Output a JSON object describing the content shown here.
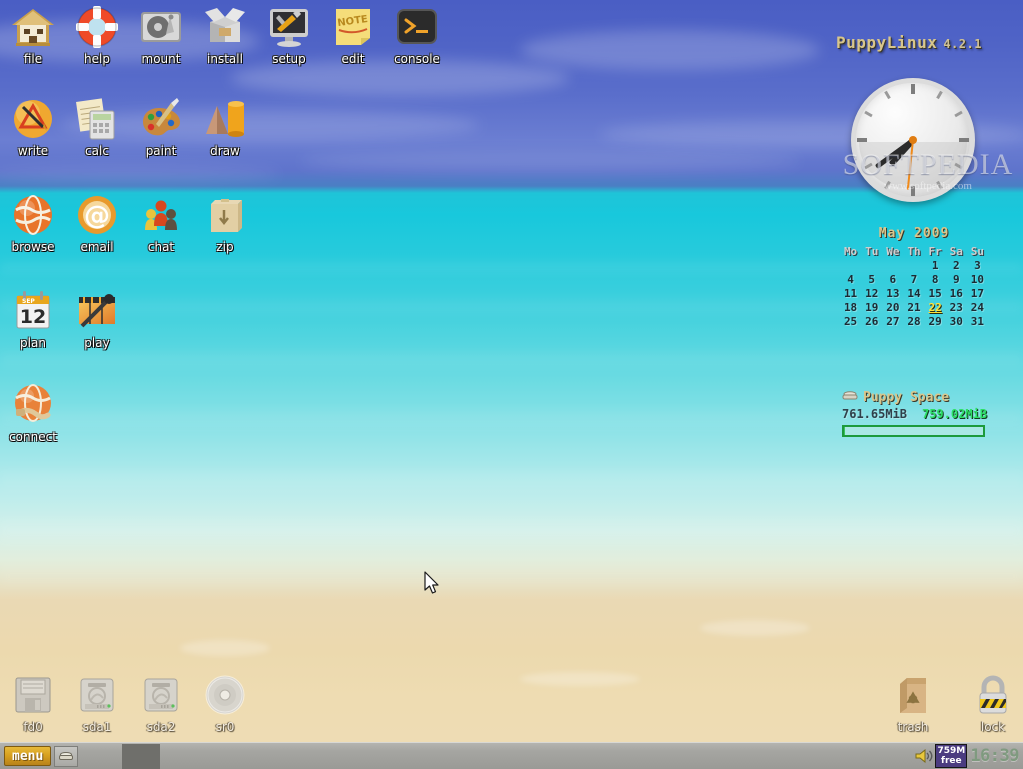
{
  "desktop": {
    "icons_top": [
      {
        "label": "file",
        "icon": "house-icon"
      },
      {
        "label": "help",
        "icon": "lifering-icon"
      },
      {
        "label": "mount",
        "icon": "harddisk-icon"
      },
      {
        "label": "install",
        "icon": "openbox-icon"
      },
      {
        "label": "setup",
        "icon": "monitor-tools-icon"
      },
      {
        "label": "edit",
        "icon": "sticky-note-icon"
      },
      {
        "label": "console",
        "icon": "terminal-icon"
      },
      {
        "label": "write",
        "icon": "pen-circle-icon"
      },
      {
        "label": "calc",
        "icon": "calculator-icon"
      },
      {
        "label": "paint",
        "icon": "palette-icon"
      },
      {
        "label": "draw",
        "icon": "shapes-icon"
      },
      {
        "label": "browse",
        "icon": "globe-icon"
      },
      {
        "label": "email",
        "icon": "at-sign-icon"
      },
      {
        "label": "chat",
        "icon": "pawns-icon"
      },
      {
        "label": "zip",
        "icon": "archive-box-icon"
      },
      {
        "label": "plan",
        "icon": "calendar-icon"
      },
      {
        "label": "play",
        "icon": "clapperboard-icon"
      },
      {
        "label": "connect",
        "icon": "globe-plug-icon"
      }
    ],
    "icons_bottom": [
      {
        "label": "fd0",
        "icon": "floppy-icon"
      },
      {
        "label": "sda1",
        "icon": "harddrive-icon"
      },
      {
        "label": "sda2",
        "icon": "harddrive-icon"
      },
      {
        "label": "sr0",
        "icon": "cdrom-icon"
      },
      {
        "label": "trash",
        "icon": "trash-bag-icon"
      },
      {
        "label": "lock",
        "icon": "padlock-icon"
      }
    ],
    "calendar_icon_month": "SEP",
    "calendar_icon_day": "12"
  },
  "branding": {
    "name": "PuppyLinux",
    "version": "4.2.1"
  },
  "watermark": {
    "title": "SOFTPEDIA",
    "url": "www.softpedia.com"
  },
  "clock": {
    "hour_deg": 222,
    "minute_deg": 234,
    "second_deg": 186
  },
  "calendar": {
    "title": "May 2009",
    "weekdays": [
      "Mo",
      "Tu",
      "We",
      "Th",
      "Fr",
      "Sa",
      "Su"
    ],
    "weeks": [
      [
        "",
        "",
        "",
        "",
        "1",
        "2",
        "3"
      ],
      [
        "4",
        "5",
        "6",
        "7",
        "8",
        "9",
        "10"
      ],
      [
        "11",
        "12",
        "13",
        "14",
        "15",
        "16",
        "17"
      ],
      [
        "18",
        "19",
        "20",
        "21",
        "22",
        "23",
        "24"
      ],
      [
        "25",
        "26",
        "27",
        "28",
        "29",
        "30",
        "31"
      ]
    ],
    "today": "22"
  },
  "puppy_space": {
    "title": "Puppy Space",
    "total": "761.65MiB",
    "free": "759.02MiB",
    "icon": "drive-icon"
  },
  "taskbar": {
    "menu_label": "menu",
    "show_desktop_icon": "desktop-icon",
    "volume_icon": "speaker-icon",
    "memory_badge": {
      "amount": "759M",
      "unit": "free"
    },
    "clock": "16:39"
  },
  "colors": {
    "menu_accent": "#d8a11f",
    "free_green": "#2ce066",
    "badge_purple": "#4b3c80",
    "brand_gold": "#d8c68c",
    "today_yellow": "#ffe23a"
  }
}
